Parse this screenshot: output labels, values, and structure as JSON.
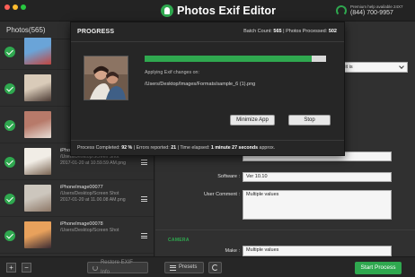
{
  "app": {
    "title": "Photos Exif Editor",
    "help_text": "Premium help available 24X7",
    "phone": "(844) 700-9957"
  },
  "sidebar": {
    "header": "Photos(565)",
    "items": [
      {
        "name": "",
        "path": "",
        "date": "",
        "thumb_colors": [
          "#6aa4d8",
          "#c2453f"
        ]
      },
      {
        "name": "",
        "path": "",
        "date": "",
        "thumb_colors": [
          "#d9cbb9",
          "#4b3a33"
        ]
      },
      {
        "name": "",
        "path": "",
        "date": "",
        "thumb_colors": [
          "#b77a6a",
          "#e7ddd6"
        ]
      },
      {
        "name": "iPhoneImage00076",
        "path": "/Users/Desktop/Screen Shot",
        "date": "2017-01-20 at 10.59.59 AM.png",
        "thumb_colors": [
          "#f1ede6",
          "#7a6553"
        ]
      },
      {
        "name": "iPhoneImage00077",
        "path": "/Users/Desktop/Screen Shot",
        "date": "2017-01-20 at 11.00.08 AM.png",
        "thumb_colors": [
          "#ccc6bd",
          "#8d7766"
        ]
      },
      {
        "name": "iPhoneImage00078",
        "path": "/Users/Desktop/Screen Shot",
        "date": "",
        "thumb_colors": [
          "#e8a15c",
          "#3b2b33"
        ]
      }
    ]
  },
  "main": {
    "dropdown_value": "as it is",
    "software_label": "Software :",
    "software_value": "Ver 10.10",
    "user_comment_label": "User Comment :",
    "user_comment_value": "Multiple values",
    "camera_section": "CAMERA",
    "make_label": "Make :",
    "make_value": "Multiple values"
  },
  "dialog": {
    "title": "PROGRESS",
    "batch_count_label": "Batch Count:",
    "batch_count": "565",
    "photos_processed_label": "Photos Processed:",
    "photos_processed": "502",
    "progress_fraction": 0.92,
    "applying_text": "Applying Exif changes on:",
    "current_path": "/Users/Desktop/Images/Formats/sample_6 (1).png",
    "minimize_label": "Minimize App",
    "stop_label": "Stop",
    "process_completed_label": "Process Completed:",
    "process_completed": "92 %",
    "errors_label": "Errors reported:",
    "errors": "21",
    "time_label": "Time elapsed:",
    "time_elapsed": "1 minute 27 seconds",
    "time_suffix": "approx."
  },
  "bottom": {
    "add": "+",
    "remove": "−",
    "restore_label": "Restore EXIF Info",
    "presets_label": "Presets",
    "start_label": "Start Process"
  },
  "colors": {
    "accent": "#2fa84f",
    "background": "#2b2b2b"
  }
}
